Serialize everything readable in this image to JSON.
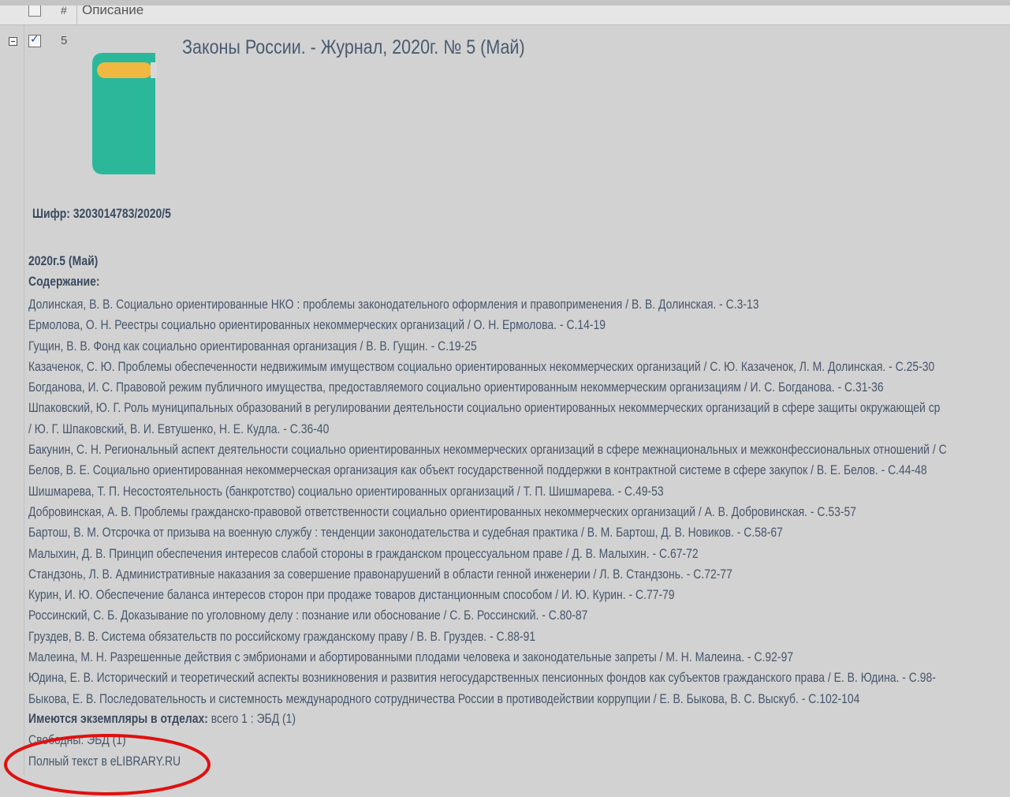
{
  "header": {
    "num_label": "#",
    "description_label": "Описание"
  },
  "record": {
    "number": "5",
    "checkbox_mark": "✓",
    "title": "Законы России. - Журнал, 2020г. № 5 (Май)",
    "cipher": "Шифр: 3203014783/2020/5",
    "issue": "2020г.5 (Май)",
    "contents_label": "Содержание:",
    "articles": [
      "Долинская, В. В. Социально ориентированные НКО : проблемы законодательного оформления и правоприменения / В. В. Долинская. - С.3-13",
      "Ермолова, О. Н. Реестры социально ориентированных некоммерческих организаций / О. Н. Ермолова. - С.14-19",
      "Гущин, В. В. Фонд как социально ориентированная организация / В. В. Гущин. - С.19-25",
      "Казаченок, С. Ю. Проблемы обеспеченности недвижимым имуществом социально ориентированных некоммерческих организаций / С. Ю. Казаченок, Л. М. Долинская. - С.25-30",
      "Богданова, И. С. Правовой режим публичного имущества, предоставляемого социально ориентированным некоммерческим организациям / И. С. Богданова. - С.31-36",
      "Шпаковский, Ю. Г. Роль муниципальных образований в регулировании деятельности социально ориентированных некоммерческих организаций в сфере защиты окружающей ср",
      "/ Ю. Г. Шпаковский, В. И. Евтушенко, Н. Е. Кудла. - С.36-40",
      "Бакунин, С. Н. Региональный аспект деятельности социально ориентированных некоммерческих организаций в сфере межнациональных и межконфессиональных отношений / С",
      "Белов, В. Е. Социально ориентированная некоммерческая организация как объект государственной поддержки в контрактной системе в сфере закупок / В. Е. Белов. - С.44-48",
      "Шишмарева, Т. П. Несостоятельность (банкротство) социально ориентированных организаций / Т. П. Шишмарева. - С.49-53",
      "Добровинская, А. В. Проблемы гражданско-правовой ответственности социально ориентированных некоммерческих организаций / А. В. Добровинская. - С.53-57",
      "Бартош, В. М. Отсрочка от призыва на военную службу : тенденции законодательства и судебная практика / В. М. Бартош, Д. В. Новиков. - С.58-67",
      "Малыхин, Д. В. Принцип обеспечения интересов слабой стороны в гражданском процессуальном праве / Д. В. Малыхин. - С.67-72",
      "Стандзонь, Л. В. Административные наказания за совершение правонарушений в области генной инженерии / Л. В. Стандзонь. - С.72-77",
      "Курин, И. Ю. Обеспечение баланса интересов сторон при продаже товаров дистанционным способом / И. Ю. Курин. - С.77-79",
      "Россинский, С. Б. Доказывание по уголовному делу : познание или обоснование / С. Б. Россинский. - С.80-87",
      "Груздев, В. В. Система обязательств по российскому гражданскому праву / В. В. Груздев. - С.88-91",
      "Малеина, М. Н. Разрешенные действия с эмбрионами и абортированными плодами человека и законодательные запреты / М. Н. Малеина. - С.92-97",
      "Юдина, Е. В. Исторический и теоретический аспекты возникновения и развития негосударственных пенсионных фондов как субъектов гражданского права / Е. В. Юдина. - С.98-",
      "Быкова, Е. В. Последовательность и системность международного сотрудничества России в противодействии коррупции / Е. В. Быкова, В. С. Выскуб. - С.102-104"
    ],
    "copies_label": "Имеются экземпляры в отделах:",
    "copies_value": " всего 1 : ЭБД (1)",
    "free": "Свободны: ЭБД (1)",
    "fulltext_link": "Полный текст в eLIBRARY.RU"
  },
  "colors": {
    "background": "#d2d2d2",
    "book_body": "#2bb89a",
    "book_label": "#f0b840",
    "annotation_circle": "#e01010"
  },
  "icons": {
    "expand": "collapse-minus-icon",
    "book": "book-icon",
    "checkbox": "checkbox-checked-icon"
  }
}
